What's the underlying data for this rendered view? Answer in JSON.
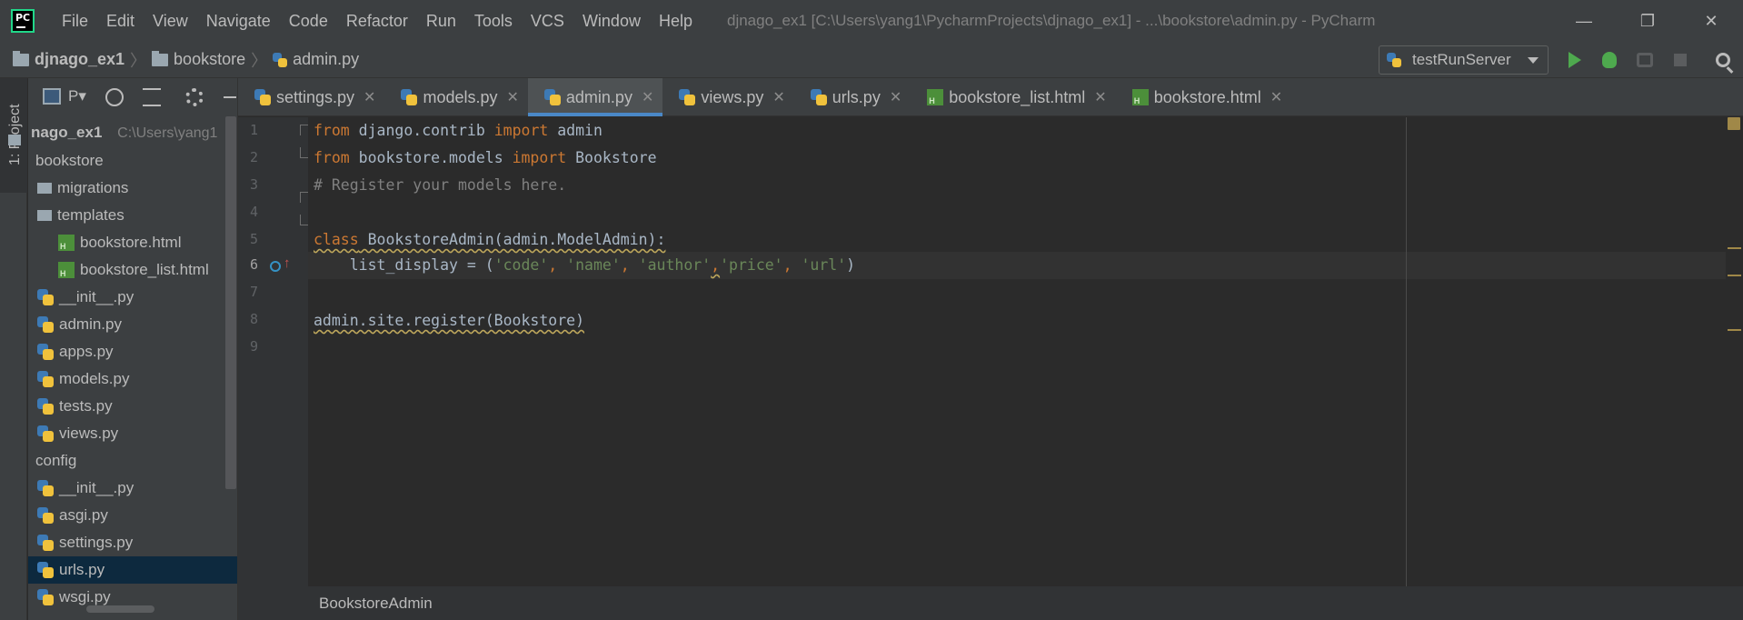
{
  "app": {
    "logo_text": "PC",
    "window_title": "djnago_ex1 [C:\\Users\\yang1\\PycharmProjects\\djnago_ex1] - ...\\bookstore\\admin.py - PyCharm"
  },
  "menu": [
    "File",
    "Edit",
    "View",
    "Navigate",
    "Code",
    "Refactor",
    "Run",
    "Tools",
    "VCS",
    "Window",
    "Help"
  ],
  "window_controls": {
    "minimize": "—",
    "restore": "❐",
    "close": "✕"
  },
  "navbar": {
    "breadcrumbs": [
      "djnago_ex1",
      "bookstore",
      "admin.py"
    ],
    "run_config": "testRunServer"
  },
  "tool_stripe": {
    "project_tab": "1: Project"
  },
  "project_panel": {
    "view_label": "P▾",
    "root_name": "nago_ex1",
    "root_path": "C:\\Users\\yang1",
    "items": [
      {
        "label": "bookstore",
        "type": "folder",
        "depth": 0
      },
      {
        "label": "migrations",
        "type": "folder",
        "depth": 1
      },
      {
        "label": "templates",
        "type": "folder",
        "depth": 1
      },
      {
        "label": "bookstore.html",
        "type": "html",
        "depth": 2
      },
      {
        "label": "bookstore_list.html",
        "type": "html",
        "depth": 2
      },
      {
        "label": "__init__.py",
        "type": "py",
        "depth": 1
      },
      {
        "label": "admin.py",
        "type": "py",
        "depth": 1
      },
      {
        "label": "apps.py",
        "type": "py",
        "depth": 1
      },
      {
        "label": "models.py",
        "type": "py",
        "depth": 1
      },
      {
        "label": "tests.py",
        "type": "py",
        "depth": 1
      },
      {
        "label": "views.py",
        "type": "py",
        "depth": 1
      },
      {
        "label": "config",
        "type": "folder",
        "depth": 0
      },
      {
        "label": "__init__.py",
        "type": "py",
        "depth": 1
      },
      {
        "label": "asgi.py",
        "type": "py",
        "depth": 1
      },
      {
        "label": "settings.py",
        "type": "py",
        "depth": 1
      },
      {
        "label": "urls.py",
        "type": "py",
        "depth": 1,
        "selected": true
      },
      {
        "label": "wsgi.py",
        "type": "py",
        "depth": 1
      }
    ]
  },
  "editor_tabs": [
    {
      "label": "settings.py",
      "icon": "python-file-icon"
    },
    {
      "label": "models.py",
      "icon": "python-file-icon"
    },
    {
      "label": "admin.py",
      "icon": "python-file-icon",
      "active": true
    },
    {
      "label": "views.py",
      "icon": "python-file-icon"
    },
    {
      "label": "urls.py",
      "icon": "python-file-icon"
    },
    {
      "label": "bookstore_list.html",
      "icon": "html-file-icon"
    },
    {
      "label": "bookstore.html",
      "icon": "html-file-icon"
    }
  ],
  "tab_close_glyph": "✕",
  "editor": {
    "current_line": 6,
    "line_numbers": [
      "1",
      "2",
      "3",
      "4",
      "5",
      "6",
      "7",
      "8",
      "9"
    ],
    "code": {
      "l1_kw1": "from",
      "l1_mod": " django.contrib ",
      "l1_kw2": "import",
      "l1_name": " admin",
      "l2_kw1": "from",
      "l2_mod": " bookstore.models ",
      "l2_kw2": "import",
      "l2_name": " Bookstore",
      "l3_comment": "# Register your models here.",
      "l5_kw": "class",
      "l5_rest": " BookstoreAdmin(admin.ModelAdmin):",
      "l6_pre": "    list_display = (",
      "l6_s1": "'code'",
      "l6_c1": ", ",
      "l6_s2": "'name'",
      "l6_c2": ", ",
      "l6_s3": "'author'",
      "l6_c3": ",",
      "l6_s4": "'price'",
      "l6_c4": ", ",
      "l6_s5": "'url'",
      "l6_post": ")",
      "l8": "admin.site.register(Bookstore)"
    }
  },
  "editor_breadcrumb": "BookstoreAdmin",
  "colors": {
    "background": "#2b2b2b",
    "panel": "#3c3f41",
    "keyword": "#cc7832",
    "string": "#6a8759",
    "comment": "#808080",
    "selection": "#0d293e",
    "accent": "#4a88c7"
  }
}
